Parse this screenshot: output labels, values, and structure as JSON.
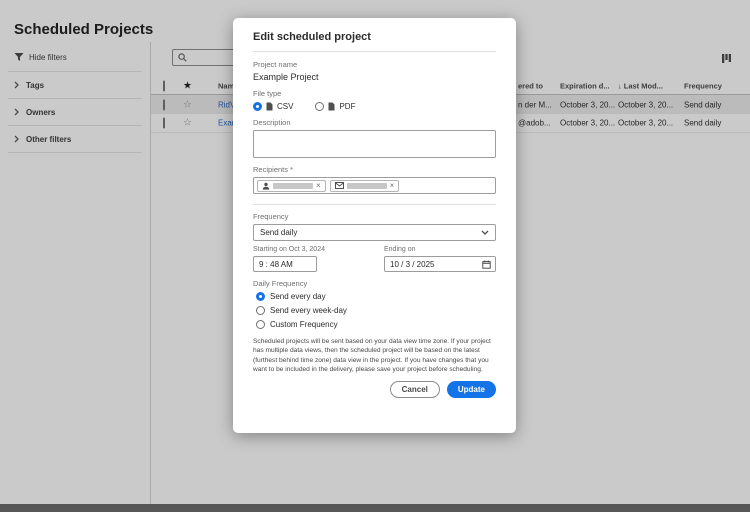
{
  "colors": {
    "accent": "#1473e6",
    "link": "#2667c9"
  },
  "page": {
    "title": "Scheduled Projects",
    "sidebar": {
      "hide_filters": "Hide filters",
      "groups": [
        {
          "label": "Tags"
        },
        {
          "label": "Owners"
        },
        {
          "label": "Other filters"
        }
      ]
    },
    "table": {
      "header": {
        "star": "★",
        "name": "Name",
        "delivered_to": "ered to",
        "expiration": "Expiration d...",
        "sort_arrow": "↓",
        "last_modified": "Last Mod...",
        "frequency": "Frequency"
      },
      "rows": [
        {
          "star": "☆",
          "name": "RidVe",
          "delivered_to": "n der M...",
          "expiration": "October 3, 20...",
          "last_modified": "October 3, 20...",
          "frequency": "Send daily"
        },
        {
          "star": "☆",
          "name": "Exam",
          "delivered_to": "@adob...",
          "expiration": "October 3, 20...",
          "last_modified": "October 3, 20...",
          "frequency": "Send daily"
        }
      ]
    }
  },
  "modal": {
    "title": "Edit scheduled project",
    "project_name": {
      "label": "Project name",
      "value": "Example Project"
    },
    "file_type": {
      "label": "File type",
      "options": [
        {
          "label": "CSV"
        },
        {
          "label": "PDF"
        }
      ],
      "selected": "CSV"
    },
    "description": {
      "label": "Description",
      "value": ""
    },
    "recipients": {
      "label": "Recipients *",
      "pills": [
        {
          "type": "user",
          "close": "×"
        },
        {
          "type": "email",
          "close": "×"
        }
      ]
    },
    "frequency": {
      "label": "Frequency",
      "value": "Send daily"
    },
    "starting": {
      "label": "Starting on Oct 3, 2024",
      "time_value": "9 : 48  AM"
    },
    "ending": {
      "label": "Ending on",
      "date_value": "10 /  3 / 2025"
    },
    "daily_frequency": {
      "label": "Daily Frequency",
      "options": [
        {
          "label": "Send every day"
        },
        {
          "label": "Send every week-day"
        },
        {
          "label": "Custom Frequency"
        }
      ],
      "selected": "Send every day"
    },
    "note": "Scheduled projects will be sent based on your data view time zone. If your project has multiple data views, then the scheduled project will be based on the latest (furthest behind time zone) data view in the project. If you have changes that you want to be included in the delivery, please save your project before scheduling.",
    "buttons": {
      "cancel": "Cancel",
      "update": "Update"
    }
  }
}
